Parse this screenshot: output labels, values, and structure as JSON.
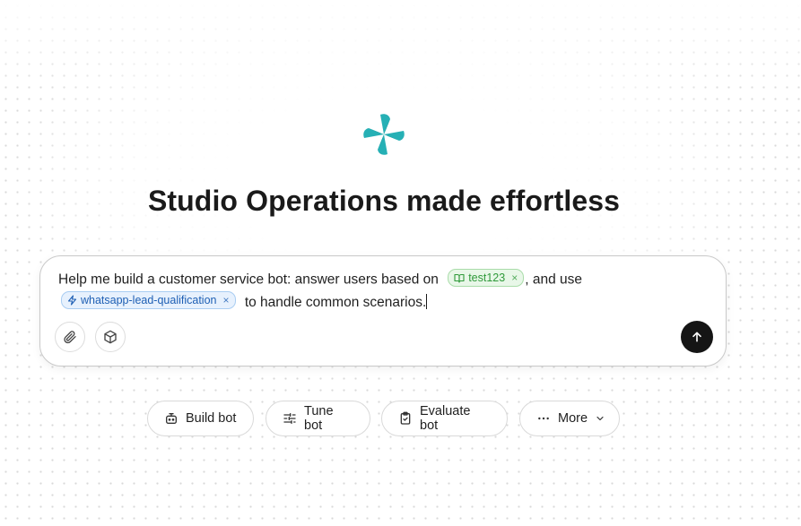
{
  "headline": "Studio Operations made effortless",
  "composer": {
    "text_before": "Help me build a customer service bot: answer users based on",
    "knowledge_chip": {
      "label": "test123",
      "remove": "×"
    },
    "text_middle": ", and use",
    "skill_chip": {
      "label": "whatsapp-lead-qualification",
      "remove": "×"
    },
    "text_after": "to handle common scenarios."
  },
  "icons": {
    "logo": "pinwheel-logo",
    "attach": "paperclip-icon",
    "box": "cube-icon",
    "send": "arrow-up-icon"
  },
  "actions": [
    {
      "label": "Build bot",
      "icon": "bot-icon"
    },
    {
      "label": "Tune bot",
      "icon": "sliders-icon"
    },
    {
      "label": "Evaluate bot",
      "icon": "clipboard-check-icon"
    },
    {
      "label": "More",
      "icon": "more-dots-icon"
    }
  ],
  "colors": {
    "brand": "#26b0b5",
    "send_button": "#151515",
    "chip_green_text": "#2f9a3a",
    "chip_blue_text": "#1e5fb4"
  }
}
